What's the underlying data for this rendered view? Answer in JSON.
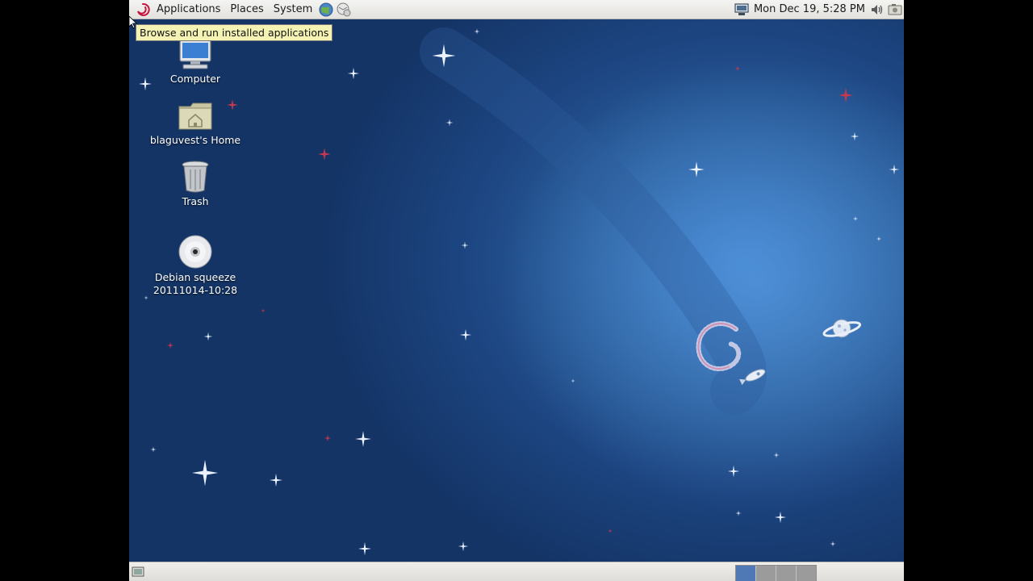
{
  "top_panel": {
    "menus": [
      "Applications",
      "Places",
      "System"
    ],
    "clock": "Mon Dec 19,  5:28 PM",
    "icons": {
      "logo": "debian-swirl-icon",
      "browser": "web-browser-icon",
      "mail": "mail-client-icon",
      "network": "network-icon",
      "volume": "volume-icon",
      "screenshot": "screenshot-icon"
    }
  },
  "tooltip": "Browse and run installed applications",
  "desktop": {
    "icons": [
      {
        "label": "Computer",
        "icon": "computer-icon"
      },
      {
        "label": "blaguvest's Home",
        "icon": "home-folder-icon"
      },
      {
        "label": "Trash",
        "icon": "trash-icon"
      },
      {
        "label": "Debian squeeze 20111014-10:28",
        "icon": "optical-disc-icon"
      }
    ]
  },
  "bottom_panel": {
    "show_desktop_icon": "show-desktop-icon",
    "workspaces": 4,
    "active_workspace": 1
  },
  "colors": {
    "panel": "#e8e7e3",
    "tooltip": "#f5f3b4",
    "desktop_dark": "#143466",
    "desktop_light": "#3b7bc8",
    "workspace_active": "#4f79b4"
  }
}
